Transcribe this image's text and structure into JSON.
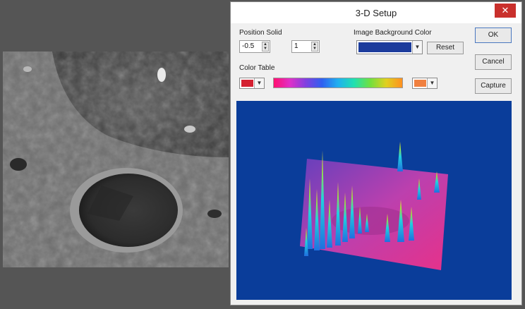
{
  "dialog": {
    "title": "3-D Setup",
    "close_glyph": "✕",
    "position_solid_label": "Position Solid",
    "position_value_1": "-0.5",
    "position_value_2": "1",
    "bg_color_label": "Image Background Color",
    "bg_color": "#1c3c9c",
    "reset_label": "Reset",
    "color_table_label": "Color Table",
    "color_table_low": "#d42030",
    "color_table_high": "#f08040",
    "ok_label": "OK",
    "cancel_label": "Cancel",
    "capture_label": "Capture"
  },
  "icons": {
    "spin_up": "▲",
    "spin_down": "▼",
    "dropdown": "▼"
  }
}
